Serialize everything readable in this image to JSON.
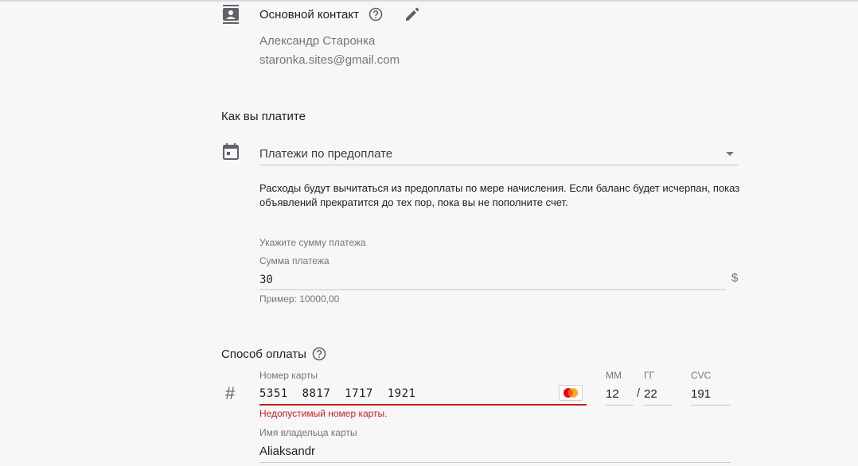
{
  "contact": {
    "title": "Основной контакт",
    "name": "Александр Старонка",
    "email": "staronka.sites@gmail.com"
  },
  "payment": {
    "section_title": "Как вы платите",
    "type_value": "Платежи по предоплате",
    "description_line1": "Расходы будут вычитаться из предоплаты по мере начисления. Если баланс будет исчерпан, показ",
    "description_line2": "объявлений прекратится до тех пор, пока вы не пополните счет.",
    "amount_hint": "Укажите сумму платежа",
    "amount_label": "Сумма платежа",
    "amount_value": "30",
    "currency": "$",
    "amount_example": "Пример: 10000,00"
  },
  "method": {
    "section_title": "Способ оплаты",
    "hash_symbol": "#",
    "card_number_label": "Номер карты",
    "card_number_value": "5351  8817  1717  1921",
    "card_brand": "MasterCard",
    "card_error": "Недопустимый номер карты.",
    "mm_label": "ММ",
    "mm_value": "12",
    "yy_label": "ГГ",
    "yy_value": "22",
    "date_separator": "/",
    "cvc_label": "CVC",
    "cvc_value": "191",
    "holder_label": "Имя владельца карты",
    "holder_value": "Aliaksandr"
  },
  "colors": {
    "error": "#c5221f",
    "icon": "#5f6368",
    "background": "#f7f7f7"
  },
  "icons": [
    "contact-card-icon",
    "help-icon",
    "edit-pencil-icon",
    "calendar-icon",
    "dropdown-caret-icon",
    "mastercard-icon"
  ]
}
